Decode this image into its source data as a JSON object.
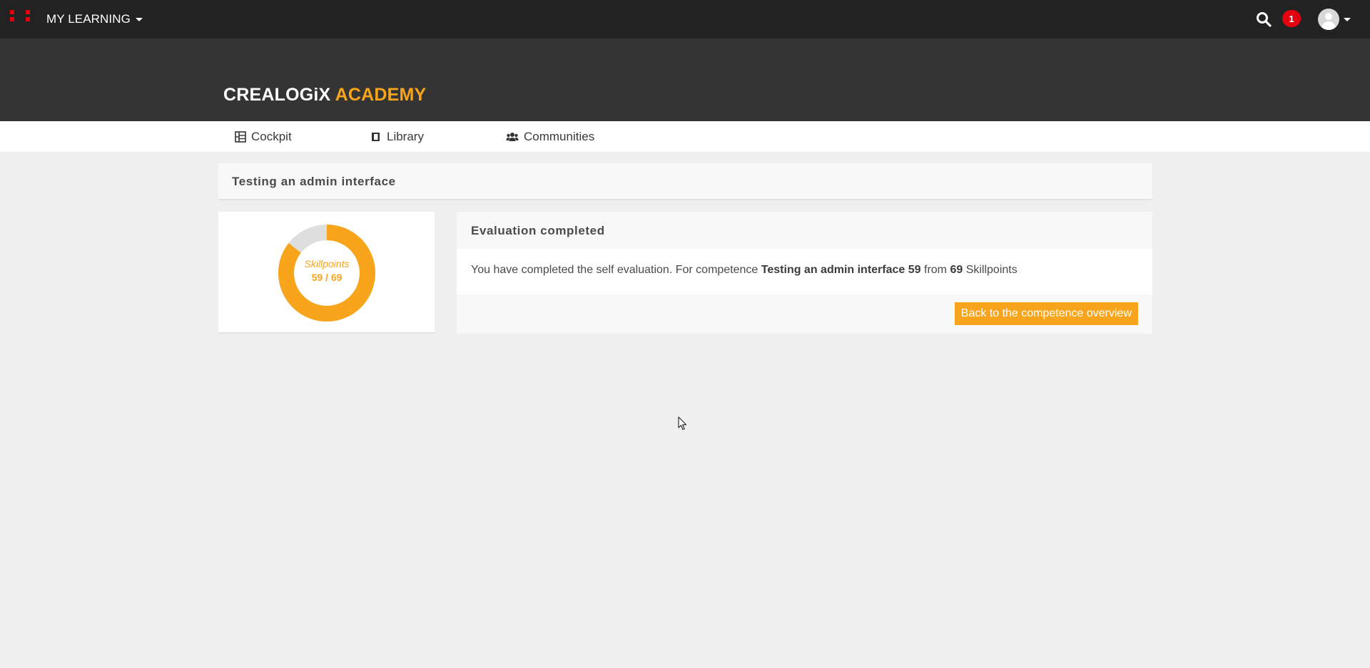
{
  "topbar": {
    "menu_label": "MY LEARNING",
    "notification_count": "1",
    "icons": [
      "apps-grid-icon",
      "search-icon",
      "user-avatar-icon"
    ]
  },
  "brand": {
    "part1": "CREALOGiX",
    "part2": " ACADEMY",
    "color_accent": "#f8a51b"
  },
  "nav": {
    "items": [
      {
        "label": "Cockpit",
        "icon": "cockpit-icon"
      },
      {
        "label": "Library",
        "icon": "library-icon"
      },
      {
        "label": "Communities",
        "icon": "communities-icon"
      }
    ]
  },
  "page": {
    "title": "Testing an admin interface"
  },
  "skillpoints": {
    "label": "Skillpoints",
    "achieved": 59,
    "total": 69,
    "display": "59 / 69",
    "color_filled": "#f8a51b",
    "color_remaining": "#dedede"
  },
  "evaluation": {
    "heading": "Evaluation completed",
    "msg_prefix": "You have completed the self evaluation. For competence ",
    "competence": "Testing an admin interface",
    "points": "59",
    "from_word": " from ",
    "total": "69",
    "suffix": " Skillpoints",
    "button_label": "Back to the competence overview"
  }
}
